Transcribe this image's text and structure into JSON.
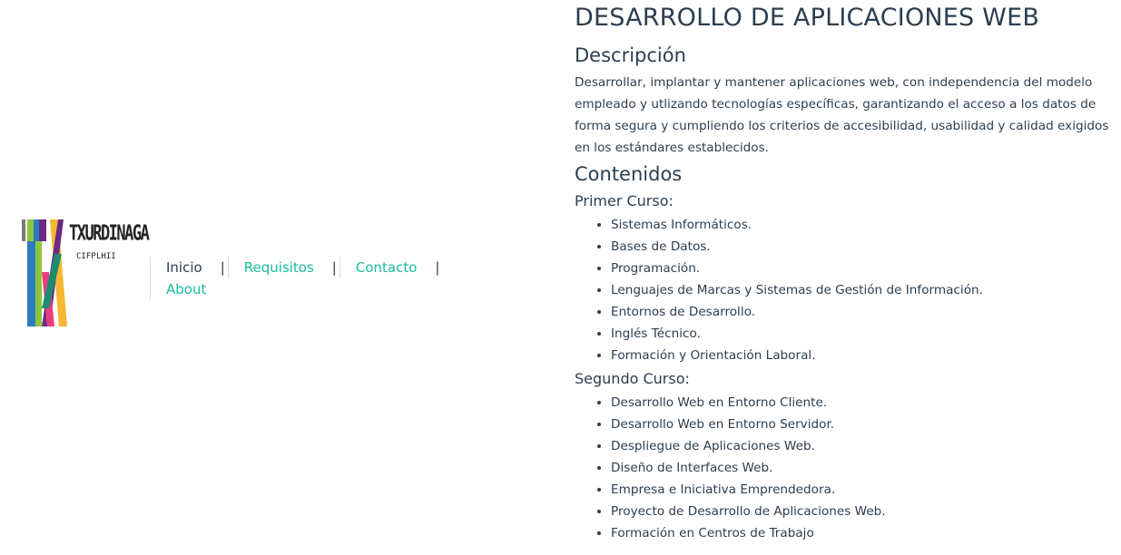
{
  "logo": {
    "name": "TXURDINAGA",
    "sub_left": "CIFP",
    "sub_right": "LHII",
    "colors": [
      "#7a7a7a",
      "#8dc63f",
      "#2e7cc0",
      "#6a2a83",
      "#1f8a70",
      "#e83e7e",
      "#f7b733"
    ]
  },
  "nav": {
    "items": [
      {
        "label": "Inicio",
        "active": true
      },
      {
        "label": "Requisitos",
        "active": false
      },
      {
        "label": "Contacto",
        "active": false
      },
      {
        "label": "About",
        "active": false
      }
    ],
    "separator": "|",
    "link_color": "#18bc9c"
  },
  "content": {
    "title": "DESARROLLO DE APLICACIONES WEB",
    "description_heading": "Descripción",
    "description": "Desarrollar, implantar y mantener aplicaciones web, con independencia del modelo empleado y utlizando tecnologías específicas, garantizando el acceso a los datos de forma segura y cumpliendo los criterios de accesibilidad, usabilidad y calidad exigidos en los estándares establecidos.",
    "contents_heading": "Contenidos",
    "first_year": {
      "label": "Primer Curso:",
      "subjects": [
        "Sistemas Informáticos.",
        "Bases de Datos.",
        "Programación.",
        "Lenguajes de Marcas y Sistemas de Gestión de Información.",
        "Entornos de Desarrollo.",
        "Inglés Técnico.",
        "Formación y Orientación Laboral."
      ]
    },
    "second_year": {
      "label": "Segundo Curso:",
      "subjects": [
        "Desarrollo Web en Entorno Cliente.",
        "Desarrollo Web en Entorno Servidor.",
        "Despliegue de Aplicaciones Web.",
        "Diseño de Interfaces Web.",
        "Empresa e Iniciativa Emprendedora.",
        "Proyecto de Desarrollo de Aplicaciones Web.",
        "Formación en Centros de Trabajo"
      ]
    }
  }
}
